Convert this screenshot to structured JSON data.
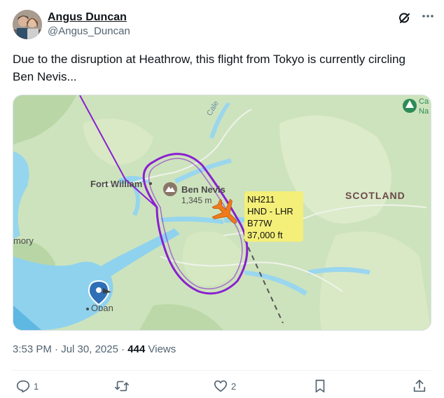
{
  "author": {
    "display_name": "Angus Duncan",
    "handle": "@Angus_Duncan"
  },
  "tweet": {
    "text": "Due to the disruption at Heathrow, this flight from Tokyo is currently circling Ben Nevis..."
  },
  "map": {
    "labels": {
      "fort_william": "Fort William",
      "ben_nevis": "Ben Nevis",
      "ben_nevis_height": "1,345 m",
      "scotland": "SCOTLAND",
      "mory": "mory",
      "oban": "Oban",
      "caledonian": "Cale",
      "cn_top": "Ca",
      "cn_bottom": "Na"
    },
    "flight": {
      "number": "NH211",
      "route": "HND - LHR",
      "aircraft": "B77W",
      "altitude": "37,000 ft"
    },
    "colors": {
      "track": "#8a1fd0",
      "plane": "#f07a1a",
      "label_bg": "#f4ef78",
      "land": "#cfe4bf",
      "water": "#8fd3ef"
    }
  },
  "meta": {
    "time": "3:53 PM",
    "separator": "·",
    "date": "Jul 30, 2025",
    "views_count": "444",
    "views_label": "Views"
  },
  "actions": {
    "replies": "1",
    "retweets": "",
    "likes": "2"
  },
  "icons": [
    "grok-icon",
    "more-icon",
    "reply-icon",
    "retweet-icon",
    "like-icon",
    "bookmark-icon",
    "share-icon",
    "location-pin-icon",
    "mountain-icon",
    "airplane-icon",
    "tree-icon"
  ]
}
